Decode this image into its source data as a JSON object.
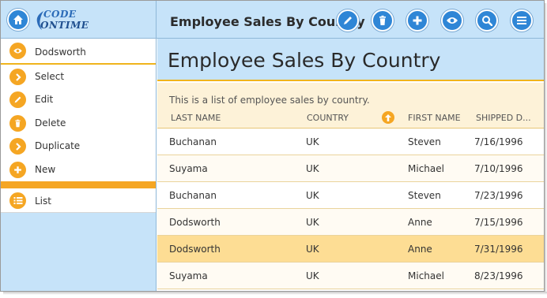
{
  "app": {
    "title": "Employee Sales By Country",
    "logo_line1": "CODE",
    "logo_line2": "ONTIME"
  },
  "toolbar": {
    "buttons": [
      {
        "name": "edit",
        "icon": "pencil-icon"
      },
      {
        "name": "delete",
        "icon": "trash-icon"
      },
      {
        "name": "new",
        "icon": "plus-icon"
      },
      {
        "name": "view",
        "icon": "eye-icon"
      },
      {
        "name": "search",
        "icon": "search-icon"
      },
      {
        "name": "menu",
        "icon": "hamburger-icon"
      }
    ]
  },
  "sidebar": {
    "context_item": {
      "label": "Dodsworth",
      "icon": "eye-icon"
    },
    "actions": [
      {
        "label": "Select",
        "icon": "chevron-right-icon"
      },
      {
        "label": "Edit",
        "icon": "pencil-icon"
      },
      {
        "label": "Delete",
        "icon": "trash-icon"
      },
      {
        "label": "Duplicate",
        "icon": "chevron-right-icon"
      },
      {
        "label": "New",
        "icon": "plus-icon"
      }
    ],
    "list_item": {
      "label": "List",
      "icon": "list-icon"
    }
  },
  "main": {
    "page_title": "Employee Sales By Country",
    "description": "This is a list of employee sales by country.",
    "columns": [
      "LAST NAME",
      "COUNTRY",
      "FIRST NAME",
      "SHIPPED D..."
    ],
    "rows": [
      {
        "last": "Buchanan",
        "country": "UK",
        "first": "Steven",
        "shipped": "7/16/1996"
      },
      {
        "last": "Suyama",
        "country": "UK",
        "first": "Michael",
        "shipped": "7/10/1996"
      },
      {
        "last": "Buchanan",
        "country": "UK",
        "first": "Steven",
        "shipped": "7/23/1996"
      },
      {
        "last": "Dodsworth",
        "country": "UK",
        "first": "Anne",
        "shipped": "7/15/1996"
      },
      {
        "last": "Dodsworth",
        "country": "UK",
        "first": "Anne",
        "shipped": "7/31/1996"
      },
      {
        "last": "Suyama",
        "country": "UK",
        "first": "Michael",
        "shipped": "8/23/1996"
      }
    ],
    "selected_row": 4
  },
  "colors": {
    "accent_orange": "#f5a623",
    "accent_blue": "#2f86d6",
    "panel_blue": "#c6e3f9",
    "selected_row": "#fddd94",
    "header_cream": "#fdf2d8"
  }
}
